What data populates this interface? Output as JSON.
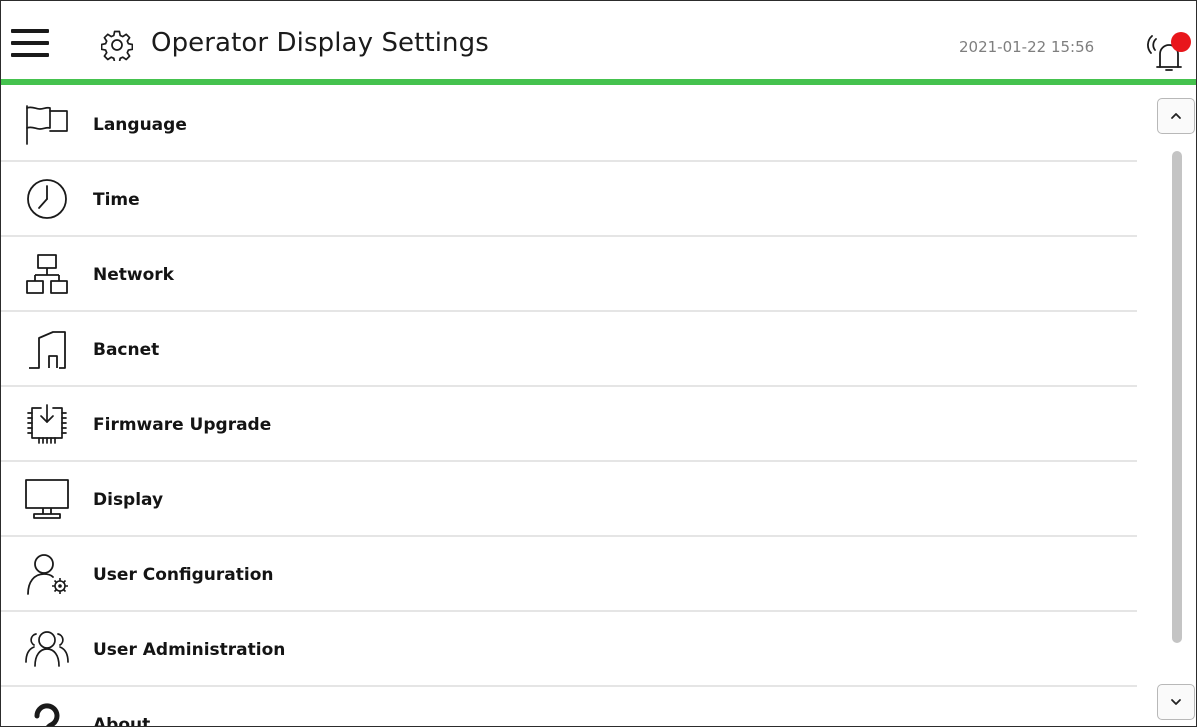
{
  "header": {
    "title": "Operator Display Settings",
    "datetime": "2021-01-22 15:56",
    "menu_icon": "hamburger-menu-icon",
    "title_icon": "gear-icon",
    "alarm_icon": "alarm-bell-icon",
    "accent_color": "#45c24e",
    "alarm_badge_color": "#e8161b"
  },
  "menu": {
    "items": [
      {
        "label": "Language",
        "icon": "flag-icon"
      },
      {
        "label": "Time",
        "icon": "clock-icon"
      },
      {
        "label": "Network",
        "icon": "network-icon"
      },
      {
        "label": "Bacnet",
        "icon": "building-icon"
      },
      {
        "label": "Firmware Upgrade",
        "icon": "firmware-chip-icon"
      },
      {
        "label": "Display",
        "icon": "monitor-icon"
      },
      {
        "label": "User Configuration",
        "icon": "user-settings-icon"
      },
      {
        "label": "User Administration",
        "icon": "users-icon"
      },
      {
        "label": "About",
        "icon": "question-icon"
      }
    ]
  },
  "scrollbar": {
    "up_icon": "chevron-up-icon",
    "down_icon": "chevron-down-icon"
  }
}
